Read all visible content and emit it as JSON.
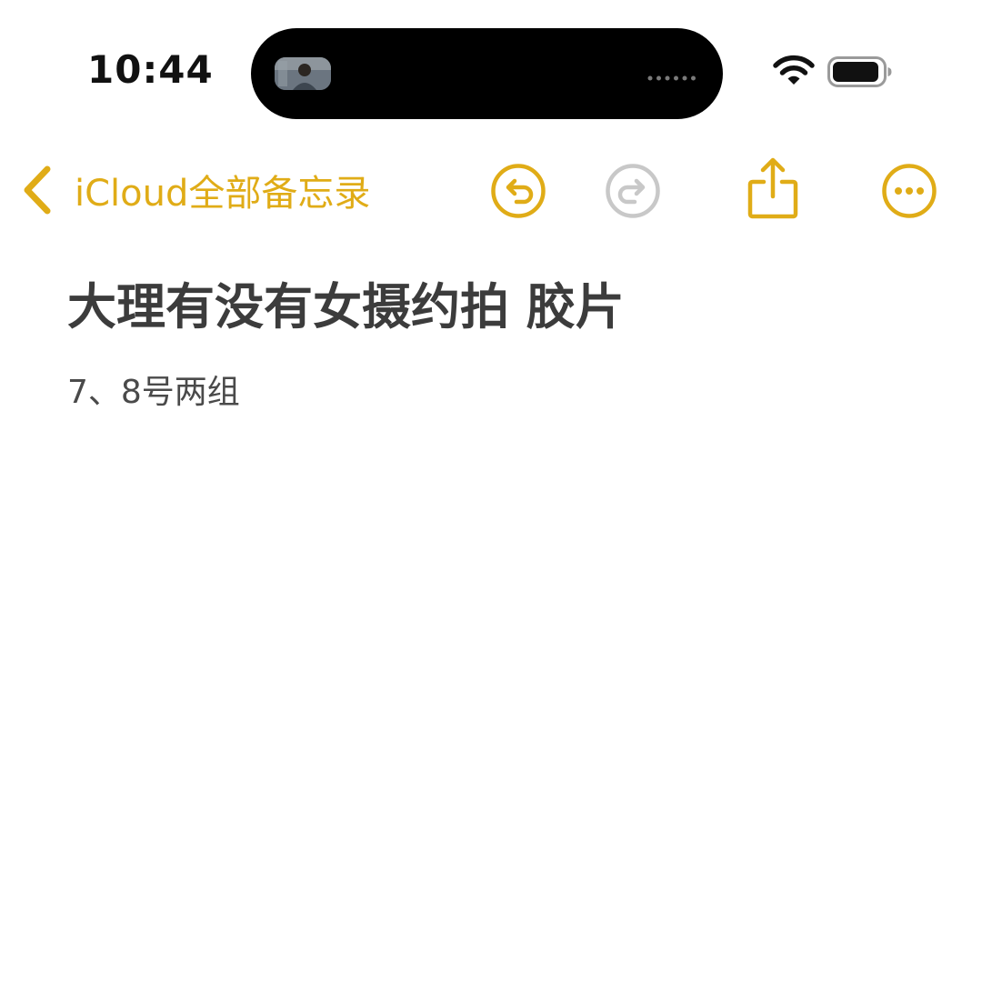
{
  "status_bar": {
    "time": "10:44",
    "icons": [
      "camera-thumbnail-icon",
      "more-dots-icon",
      "wifi-icon",
      "battery-icon"
    ]
  },
  "nav": {
    "back_label": "iCloud全部备忘录",
    "icons": [
      "back-chevron-icon",
      "undo-icon",
      "redo-icon",
      "share-icon",
      "more-icon"
    ],
    "colors": {
      "accent": "#E0AC17",
      "disabled": "#C8C8C8"
    }
  },
  "note": {
    "title": "大理有没有女摄约拍 胶片",
    "body": "7、8号两组"
  }
}
